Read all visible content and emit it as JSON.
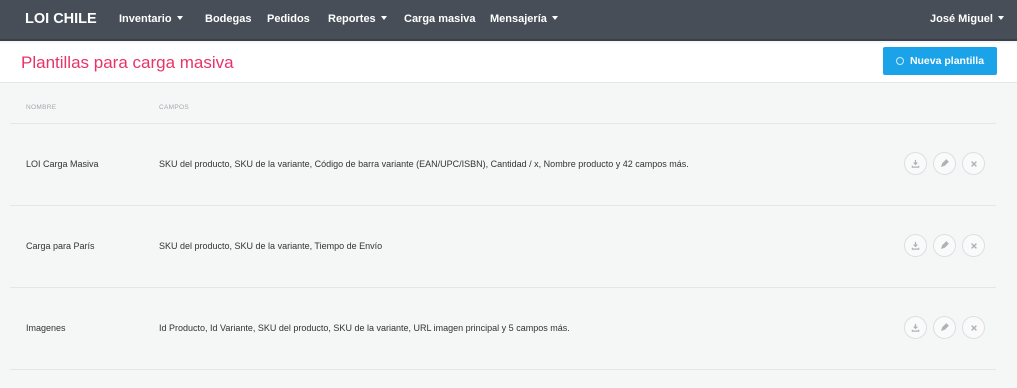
{
  "nav": {
    "brand": "LOI CHILE",
    "items": [
      {
        "label": "Inventario",
        "dropdown": true
      },
      {
        "label": "Bodegas",
        "dropdown": false
      },
      {
        "label": "Pedidos",
        "dropdown": false
      },
      {
        "label": "Reportes",
        "dropdown": true
      },
      {
        "label": "Carga masiva",
        "dropdown": false
      },
      {
        "label": "Mensajería",
        "dropdown": true
      }
    ],
    "user": "José Miguel"
  },
  "page": {
    "title": "Plantillas para carga masiva",
    "new_button": "Nueva plantilla"
  },
  "table": {
    "headers": [
      "NOMBRE",
      "CAMPOS"
    ],
    "rows": [
      {
        "name": "LOI Carga Masiva",
        "fields": "SKU del producto, SKU de la variante, Código de barra variante (EAN/UPC/ISBN), Cantidad / x, Nombre producto y 42 campos más."
      },
      {
        "name": "Carga para París",
        "fields": "SKU del producto, SKU de la variante, Tiempo de Envío"
      },
      {
        "name": "Imagenes",
        "fields": "Id Producto, Id Variante, SKU del producto, SKU de la variante, URL imagen principal y 5 campos más."
      }
    ],
    "actions": [
      "download-icon",
      "pencil-icon",
      "close-icon"
    ]
  },
  "colors": {
    "navbar": "#474e57",
    "title": "#e8336a",
    "primary_button": "#1aa3e8",
    "background": "#f5f6f6"
  }
}
